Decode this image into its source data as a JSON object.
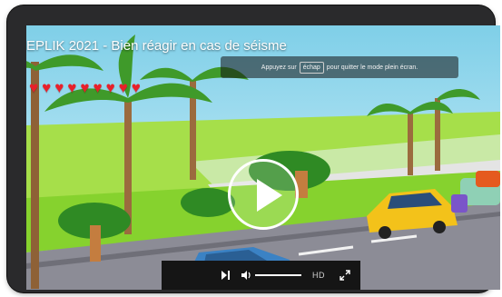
{
  "video": {
    "title": "EPLIK 2021 - Bien réagir en cas de séisme"
  },
  "fullscreen_hint": {
    "prefix": "Appuyez sur",
    "key": "échap",
    "suffix": "pour quitter le mode plein écran."
  },
  "hearts": {
    "count": 9,
    "glyph": "♥",
    "color": "#e8202a"
  },
  "controls": {
    "hd_label": "HD",
    "volume_level": 1.0,
    "play_icon": "play-icon",
    "next_icon": "skip-next-icon",
    "volume_icon": "volume-icon",
    "fullscreen_icon": "exit-fullscreen-icon"
  },
  "colors": {
    "device_frame": "#2a2a2c",
    "sky": "#9fdcf0",
    "grass": "#86d22e",
    "road": "#8c8c96",
    "control_bar": "#151515"
  }
}
